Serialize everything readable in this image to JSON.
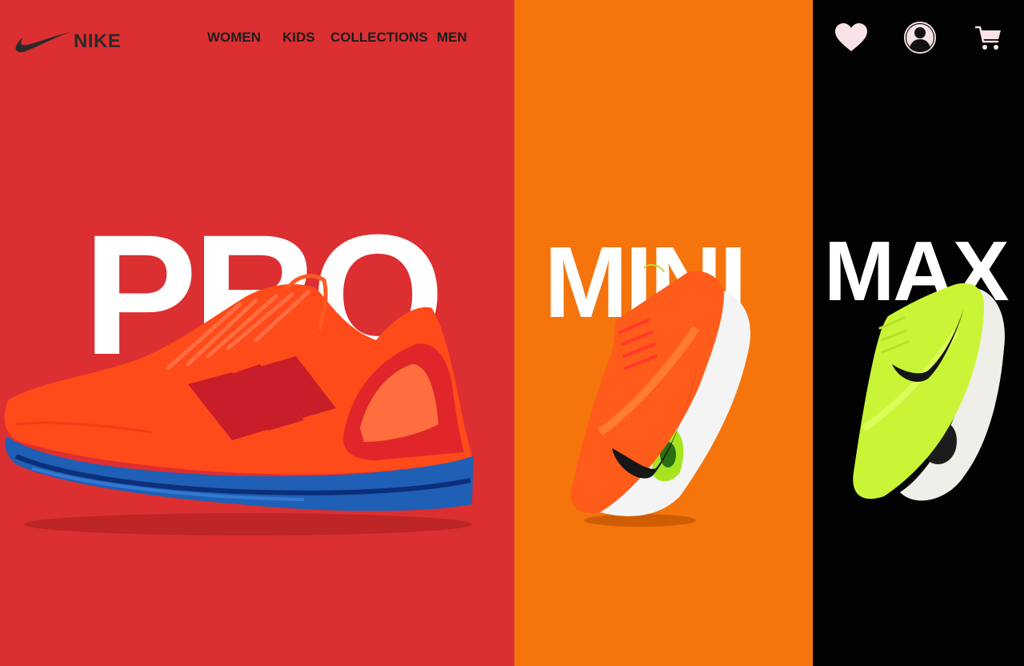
{
  "brand": {
    "name": "NIKE",
    "logo_icon": "swoosh-icon"
  },
  "nav": {
    "items": [
      {
        "label": "WOMEN"
      },
      {
        "label": "KIDS"
      },
      {
        "label": "COLLECTIONS"
      },
      {
        "label": "MEN"
      }
    ]
  },
  "header_icons": {
    "favorites": "heart-icon",
    "account": "user-icon",
    "cart": "cart-icon"
  },
  "panels": [
    {
      "word": "PRO",
      "background": "#dc2f31",
      "shoe": "red sneaker with blue sole"
    },
    {
      "word": "MINI",
      "background": "#f5740c",
      "shoe": "orange running shoe with white sole"
    },
    {
      "word": "MAX",
      "background": "#020202",
      "shoe": "neon yellow trainer with white sole"
    }
  ],
  "colors": {
    "icon_fill": "#f9e3e6",
    "nav_text": "#1d1d1d",
    "word_text": "#ffffff"
  }
}
